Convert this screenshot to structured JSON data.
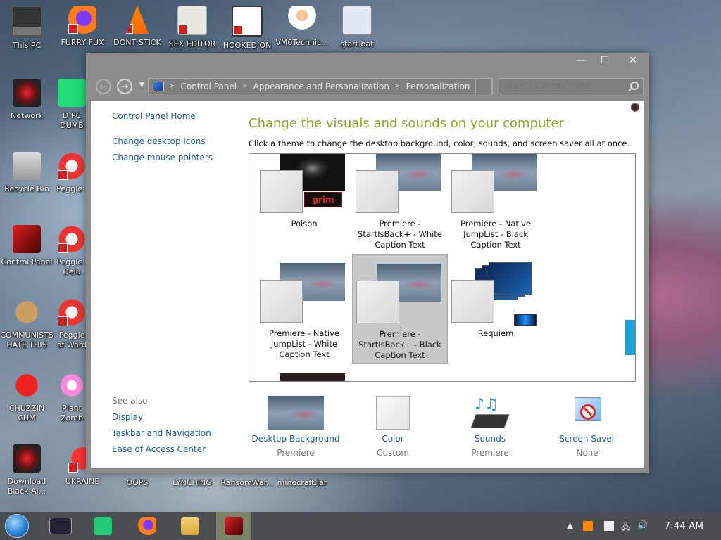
{
  "desktop": {
    "icons": [
      {
        "label": "This PC"
      },
      {
        "label": "FURRY FUX"
      },
      {
        "label": "DONT STICK"
      },
      {
        "label": "SEX EDITOR"
      },
      {
        "label": "HOOKED ON"
      },
      {
        "label": "VM0Technic..."
      },
      {
        "label": "start.bat"
      },
      {
        "label": "Network"
      },
      {
        "label": "D PC DUMB"
      },
      {
        "label": "Recycle Bin"
      },
      {
        "label": "Peggle I"
      },
      {
        "label": "Control Panel"
      },
      {
        "label": "Peggle I Delu"
      },
      {
        "label": "COMMUNISTS HATE THIS G..."
      },
      {
        "label": "Peggle of Ward"
      },
      {
        "label": "CHUZZIN CUM"
      },
      {
        "label": "Plant Zomb"
      },
      {
        "label": "Download Black Ai..."
      },
      {
        "label": "UKRAINE"
      },
      {
        "label": "OOPS"
      },
      {
        "label": "LYNCHING"
      },
      {
        "label": "RansomWar..."
      },
      {
        "label": "minecraft.jar"
      }
    ]
  },
  "window": {
    "controls": {
      "minimize": "—",
      "maximize": "☐",
      "close": "✕"
    },
    "address": {
      "crumbs": [
        "Control Panel",
        "Appearance and Personalization",
        "Personalization"
      ]
    },
    "search": {
      "placeholder": "Search Control Panel"
    },
    "left_nav": {
      "home": "Control Panel Home",
      "links": [
        "Change desktop icons",
        "Change mouse pointers"
      ],
      "see_also_title": "See also",
      "see_also": [
        "Display",
        "Taskbar and Navigation",
        "Ease of Access Center"
      ]
    },
    "heading": "Change the visuals and sounds on your computer",
    "subtext": "Click a theme to change the desktop background, color, sounds, and screen saver all at once.",
    "themes": [
      {
        "name": "Poison",
        "selected": false
      },
      {
        "name": "Premiere - StartIsBack+ - White Caption Text",
        "selected": false
      },
      {
        "name": "Premiere - Native JumpList - Black Caption Text",
        "selected": false
      },
      {
        "name": "Premiere - Native JumpList - White Caption Text",
        "selected": false
      },
      {
        "name": "Premiere - StartIsBack+ - Black Caption Text",
        "selected": true
      },
      {
        "name": "Requiem",
        "selected": false
      }
    ],
    "poison_logo_text": "grim",
    "bottom": [
      {
        "label": "Desktop Background",
        "value": "Premiere"
      },
      {
        "label": "Color",
        "value": "Custom"
      },
      {
        "label": "Sounds",
        "value": "Premiere"
      },
      {
        "label": "Screen Saver",
        "value": "None"
      }
    ]
  },
  "taskbar": {
    "clock": "7:44 AM"
  },
  "colors": {
    "heading_green": "#8aaa25",
    "link_blue": "#1c5f9e",
    "scrollbar_accent": "#19a3d4"
  }
}
